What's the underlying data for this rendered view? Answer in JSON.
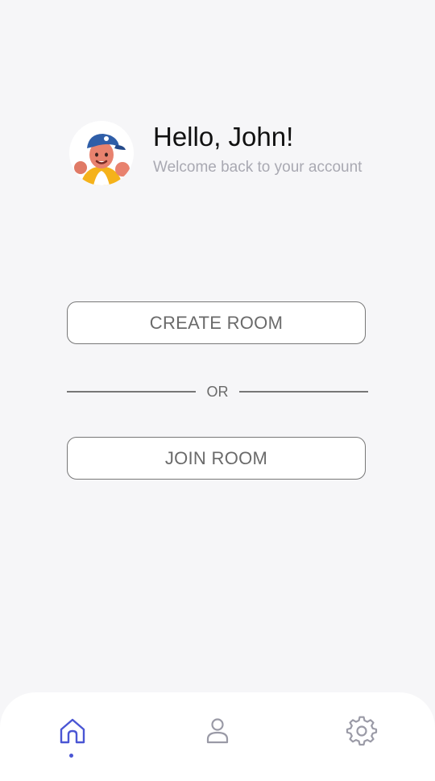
{
  "header": {
    "greeting": "Hello, John!",
    "subtitle": "Welcome back to your account"
  },
  "actions": {
    "create_label": "CREATE ROOM",
    "separator": "OR",
    "join_label": "JOIN ROOM"
  },
  "nav": {
    "items": [
      {
        "icon": "home-icon",
        "active": true
      },
      {
        "icon": "user-icon",
        "active": false
      },
      {
        "icon": "gear-icon",
        "active": false
      }
    ],
    "active_color": "#4a56d4",
    "inactive_color": "#9a9aa6"
  }
}
